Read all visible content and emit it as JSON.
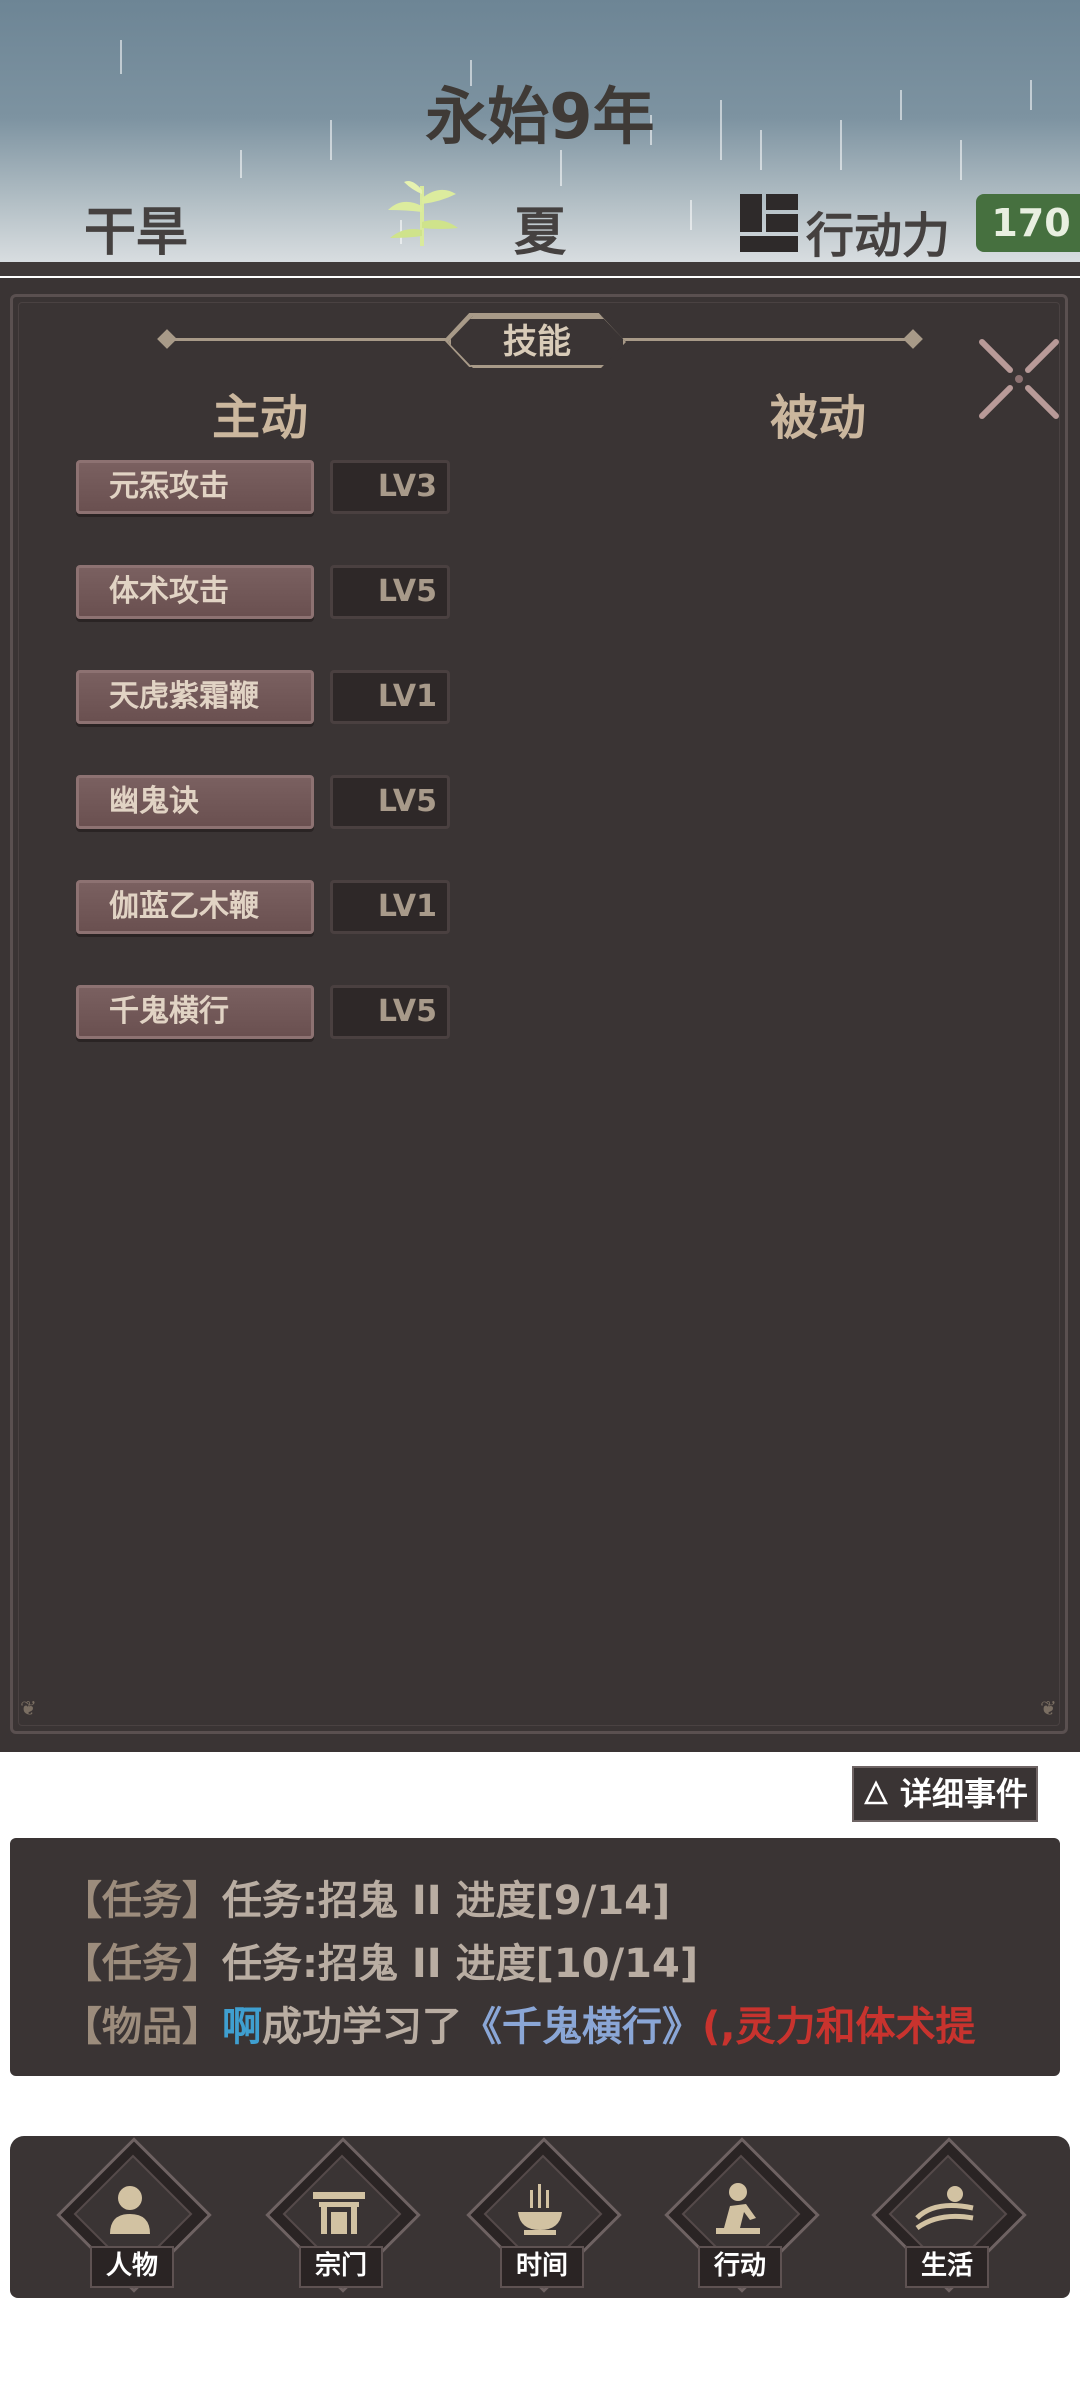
{
  "header": {
    "year": "永始9年",
    "weather": "干旱",
    "season": "夏",
    "action_label": "行动力",
    "action_value": "170"
  },
  "panel": {
    "title": "技能",
    "active_label": "主动",
    "passive_label": "被动",
    "skills": [
      {
        "name": "元炁攻击",
        "level": "LV3"
      },
      {
        "name": "体术攻击",
        "level": "LV5"
      },
      {
        "name": "天虎紫霜鞭",
        "level": "LV1"
      },
      {
        "name": "幽鬼诀",
        "level": "LV5"
      },
      {
        "name": "伽蓝乙木鞭",
        "level": "LV1"
      },
      {
        "name": "千鬼横行",
        "level": "LV5"
      }
    ]
  },
  "events": {
    "detail_label": "详细事件",
    "lines": [
      {
        "tag": "【任务】",
        "text": "任务:招鬼 II 进度[9/14]"
      },
      {
        "tag": "【任务】",
        "text": "任务:招鬼 II 进度[10/14]"
      },
      {
        "tag": "【物品】",
        "who": "啊",
        "text": "成功学习了",
        "book": "《千鬼横行》",
        "extra": "(,灵力和体术提"
      }
    ]
  },
  "nav": {
    "items": [
      {
        "label": "人物",
        "icon": "person-icon"
      },
      {
        "label": "宗门",
        "icon": "sect-gate-icon"
      },
      {
        "label": "时间",
        "icon": "incense-icon"
      },
      {
        "label": "行动",
        "icon": "action-icon"
      },
      {
        "label": "生活",
        "icon": "life-landscape-icon"
      }
    ]
  },
  "colors": {
    "panel_bg": "#3a3434",
    "action_badge": "#46703f",
    "skill_button": "#6a5050",
    "accent_text": "#cbb79e",
    "highlight_red": "#c8332e",
    "highlight_blue": "#8aa6d6"
  }
}
